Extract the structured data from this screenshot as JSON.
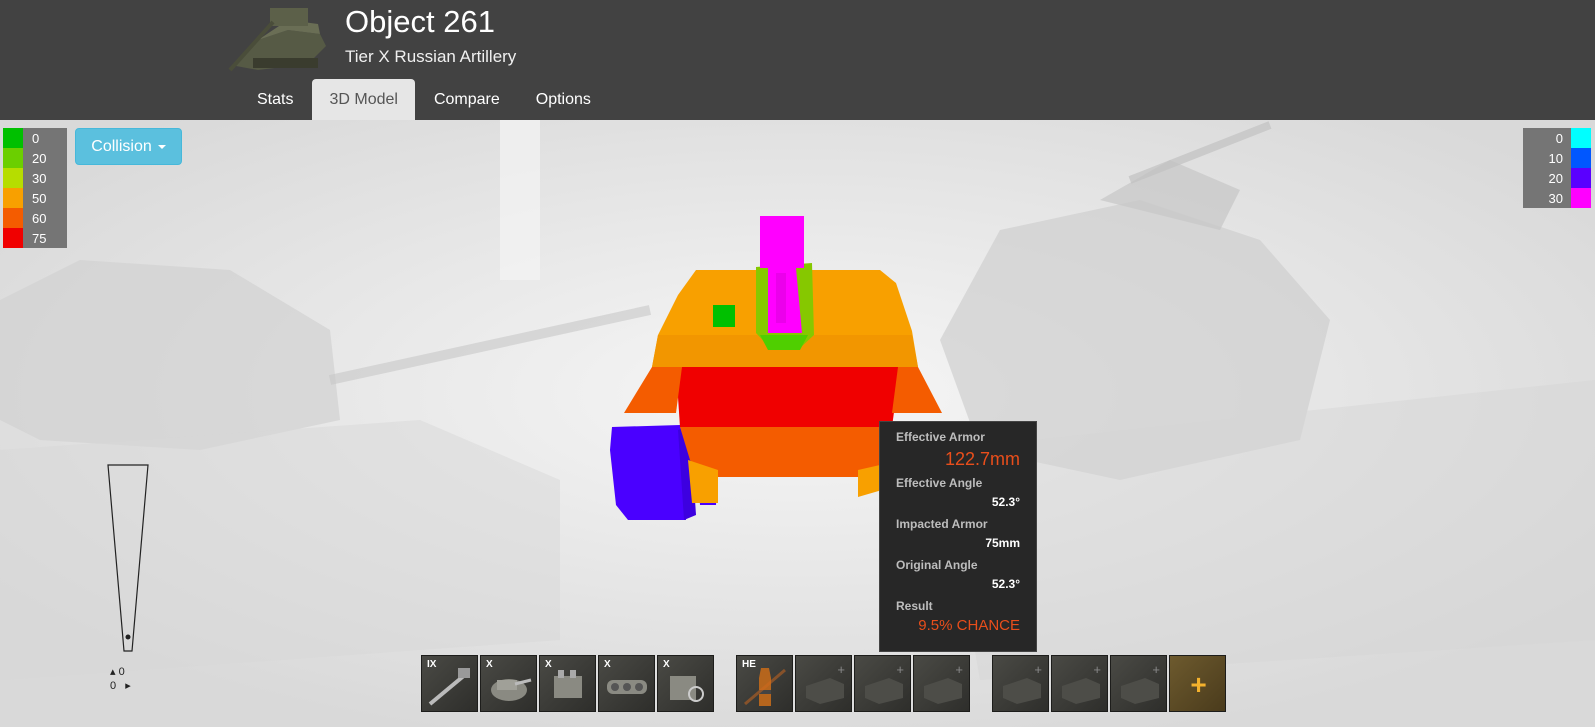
{
  "header": {
    "title": "Object 261",
    "subtitle": "Tier X Russian Artillery",
    "tabs": [
      {
        "label": "Stats"
      },
      {
        "label": "3D Model"
      },
      {
        "label": "Compare"
      },
      {
        "label": "Options"
      }
    ],
    "active_tab": "3D Model"
  },
  "legend_left": [
    {
      "value": "0",
      "color": "#00c000"
    },
    {
      "value": "20",
      "color": "#6bcf00"
    },
    {
      "value": "30",
      "color": "#b6dd00"
    },
    {
      "value": "50",
      "color": "#f8a000"
    },
    {
      "value": "60",
      "color": "#f45c00"
    },
    {
      "value": "75",
      "color": "#f00000"
    }
  ],
  "legend_right": [
    {
      "value": "0",
      "color": "#00ffff"
    },
    {
      "value": "10",
      "color": "#0057ff"
    },
    {
      "value": "20",
      "color": "#5a00ff"
    },
    {
      "value": "30",
      "color": "#ff00ff"
    }
  ],
  "collision_button": {
    "label": "Collision"
  },
  "tooltip": {
    "effective_armor_label": "Effective Armor",
    "effective_armor_value": "122.7mm",
    "effective_angle_label": "Effective Angle",
    "effective_angle_value": "52.3°",
    "impacted_armor_label": "Impacted Armor",
    "impacted_armor_value": "75mm",
    "original_angle_label": "Original Angle",
    "original_angle_value": "52.3°",
    "result_label": "Result",
    "result_value": "9.5% CHANCE"
  },
  "compass": {
    "pitch": "0",
    "yaw": "0"
  },
  "slots": {
    "modules": [
      {
        "tier": "IX",
        "icon": "gun-icon"
      },
      {
        "tier": "X",
        "icon": "turret-icon"
      },
      {
        "tier": "X",
        "icon": "engine-icon"
      },
      {
        "tier": "X",
        "icon": "tracks-icon"
      },
      {
        "tier": "X",
        "icon": "radio-icon"
      }
    ],
    "ammo": [
      {
        "tier": "HE",
        "icon": "shell-icon"
      },
      {
        "tier": "",
        "icon": "empty-slot-icon"
      },
      {
        "tier": "",
        "icon": "empty-slot-icon"
      },
      {
        "tier": "",
        "icon": "empty-slot-icon"
      }
    ],
    "equipment": [
      {
        "tier": "",
        "icon": "empty-slot-icon"
      },
      {
        "tier": "",
        "icon": "empty-slot-icon"
      },
      {
        "tier": "",
        "icon": "empty-slot-icon"
      }
    ],
    "add": {
      "label": "+"
    }
  }
}
